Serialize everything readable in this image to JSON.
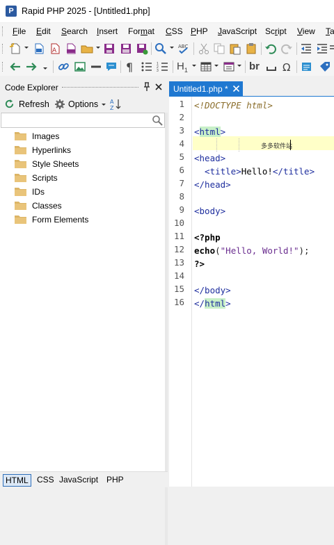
{
  "window": {
    "title": "Rapid PHP 2025 - [Untitled1.php]",
    "app_icon_letter": "P"
  },
  "menu": [
    {
      "label": "File",
      "u": "F",
      "rest": "ile"
    },
    {
      "label": "Edit",
      "u": "E",
      "rest": "dit"
    },
    {
      "label": "Search",
      "u": "S",
      "rest": "earch"
    },
    {
      "label": "Insert",
      "u": "I",
      "rest": "nsert"
    },
    {
      "label": "Format",
      "pre": "For",
      "u": "m",
      "rest": "at"
    },
    {
      "label": "CSS",
      "u": "C",
      "rest": "SS"
    },
    {
      "label": "PHP",
      "u": "P",
      "rest": "HP"
    },
    {
      "label": "JavaScript",
      "u": "J",
      "rest": "avaScript"
    },
    {
      "label": "Script",
      "pre": "Sc",
      "u": "r",
      "rest": "ipt"
    },
    {
      "label": "View",
      "u": "V",
      "rest": "iew"
    },
    {
      "label": "Ta",
      "u": "T",
      "rest": "a"
    }
  ],
  "toolbar2_text": {
    "br": "br",
    "h": "H",
    "h_sub": "1"
  },
  "code_explorer": {
    "title": "Code Explorer",
    "refresh_label": "Refresh",
    "options_label": "Options",
    "search_value": "",
    "tree": [
      "Images",
      "Hyperlinks",
      "Style Sheets",
      "Scripts",
      "IDs",
      "Classes",
      "Form Elements"
    ]
  },
  "bottom_tabs": [
    "HTML",
    "CSS",
    "JavaScript",
    "PHP"
  ],
  "editor": {
    "tab_label": "Untitled1.php *",
    "line_numbers": [
      "1",
      "2",
      "3",
      "4",
      "5",
      "6",
      "7",
      "8",
      "9",
      "10",
      "11",
      "12",
      "13",
      "14",
      "15",
      "16"
    ],
    "ime_composition": "多多软件站",
    "code": {
      "l1": "<!DOCTYPE html>",
      "l3_open": "<",
      "l3_tag": "html",
      "l3_close": ">",
      "l5": "<head>",
      "l6_open": "  <title>",
      "l6_text": "Hello!",
      "l6_close": "</title>",
      "l7": "</head>",
      "l9": "<body>",
      "l11": "<?php",
      "l12_kw": "echo",
      "l12_p1": "(",
      "l12_str": "\"Hello, World!\"",
      "l12_p2": ");",
      "l13": "?>",
      "l15": "</body>",
      "l16_open": "</",
      "l16_tag": "html",
      "l16_close": ">"
    }
  },
  "colors": {
    "accent": "#1f78d1",
    "current_line": "#ffffc8",
    "tag_match": "#c8f0c8"
  }
}
